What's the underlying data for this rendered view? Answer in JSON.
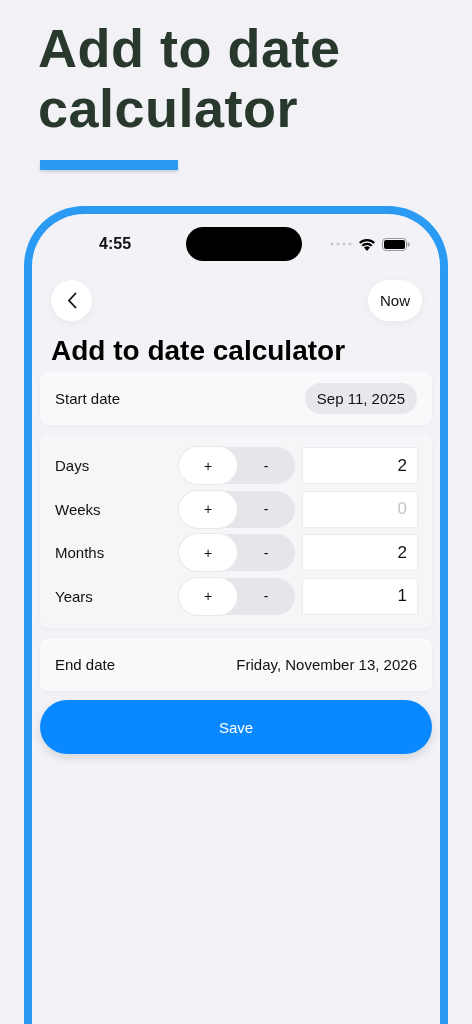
{
  "headline": "Add to date calculator",
  "status_bar": {
    "time": "4:55"
  },
  "nav": {
    "now_button": "Now"
  },
  "title": "Add to date calculator",
  "start_date": {
    "label": "Start date",
    "value": "Sep 11, 2025"
  },
  "rows": [
    {
      "label": "Days",
      "segments": [
        {
          "label": "+",
          "selected": true
        },
        {
          "label": "-",
          "selected": false
        }
      ],
      "value": "2"
    },
    {
      "label": "Weeks",
      "segments": [
        {
          "label": "+",
          "selected": true
        },
        {
          "label": "-",
          "selected": false
        }
      ],
      "placeholder": "0"
    },
    {
      "label": "Months",
      "segments": [
        {
          "label": "+",
          "selected": true
        },
        {
          "label": "-",
          "selected": false
        }
      ],
      "value": "2"
    },
    {
      "label": "Years",
      "segments": [
        {
          "label": "+",
          "selected": true
        },
        {
          "label": "-",
          "selected": false
        }
      ],
      "value": "1"
    }
  ],
  "end_date": {
    "label": "End date",
    "value": "Friday, November 13, 2026"
  },
  "save_button": "Save"
}
